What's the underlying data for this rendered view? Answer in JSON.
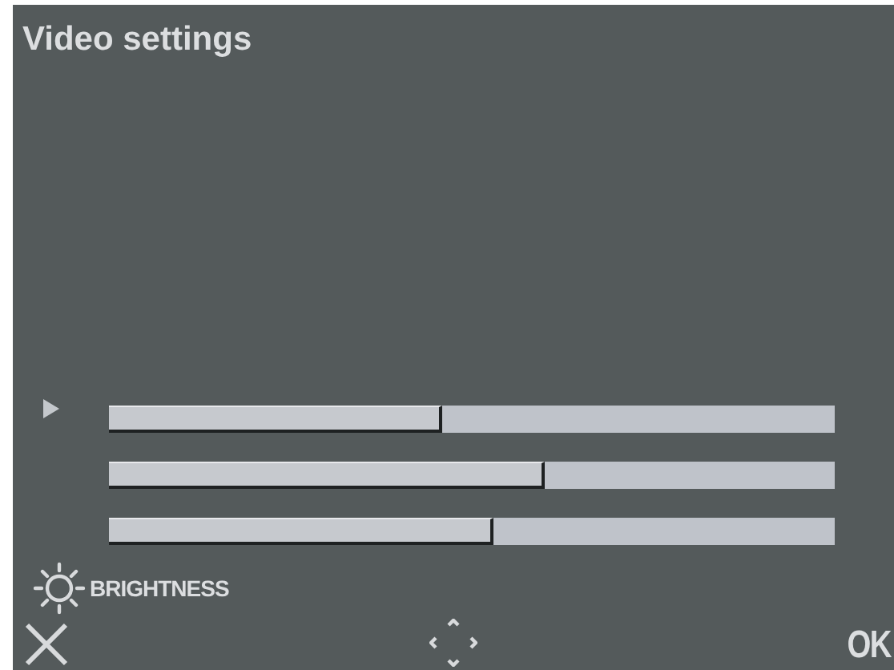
{
  "window": {
    "title": "Video settings"
  },
  "sliders": [
    {
      "selected": true,
      "level": 0.46
    },
    {
      "selected": false,
      "level": 0.6
    },
    {
      "selected": false,
      "level": 0.53
    }
  ],
  "current_setting": {
    "label": "BRIGHTNESS"
  },
  "softkeys": {
    "right": "OK"
  }
}
